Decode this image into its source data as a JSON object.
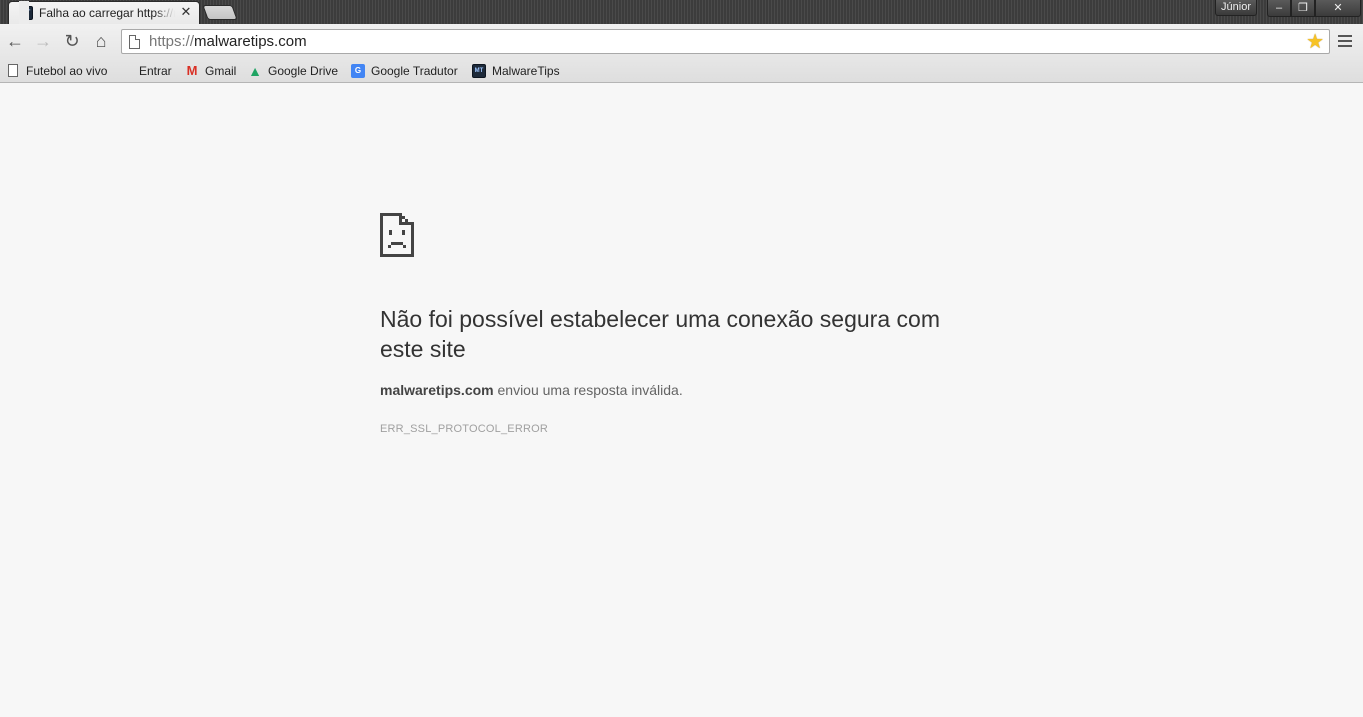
{
  "window": {
    "profile_name": "Júnior",
    "minimize_glyph": "–",
    "restore_glyph": "❐",
    "close_glyph": "✕"
  },
  "tabs": [
    {
      "title": "Falha ao carregar https://malwaretips.com",
      "favicon": "mt-favicon-icon",
      "close_glyph": "✕"
    }
  ],
  "toolbar": {
    "back_glyph": "←",
    "forward_glyph": "→",
    "reload_glyph": "↻",
    "home_glyph": "⌂",
    "url_scheme": "https://",
    "url_host": "malwaretips.com",
    "star_glyph": "★",
    "star_color": "#f7c325"
  },
  "bookmarks": [
    {
      "label": "Futebol ao vivo",
      "icon": "page-icon"
    },
    {
      "label": "Entrar",
      "icon": "microsoft-icon"
    },
    {
      "label": "Gmail",
      "icon": "gmail-icon"
    },
    {
      "label": "Google Drive",
      "icon": "google-drive-icon"
    },
    {
      "label": "Google Tradutor",
      "icon": "google-translate-icon"
    },
    {
      "label": "MalwareTips",
      "icon": "mt-favicon-icon"
    }
  ],
  "icon_text": {
    "gmail": "M",
    "drive": "▲",
    "translate": "G",
    "mt": "MT"
  },
  "error": {
    "icon": "sad-document-icon",
    "heading": "Não foi possível estabelecer uma conexão segura com este site",
    "summary_host": "malwaretips.com",
    "summary_text": " enviou uma resposta inválida.",
    "code": "ERR_SSL_PROTOCOL_ERROR"
  }
}
